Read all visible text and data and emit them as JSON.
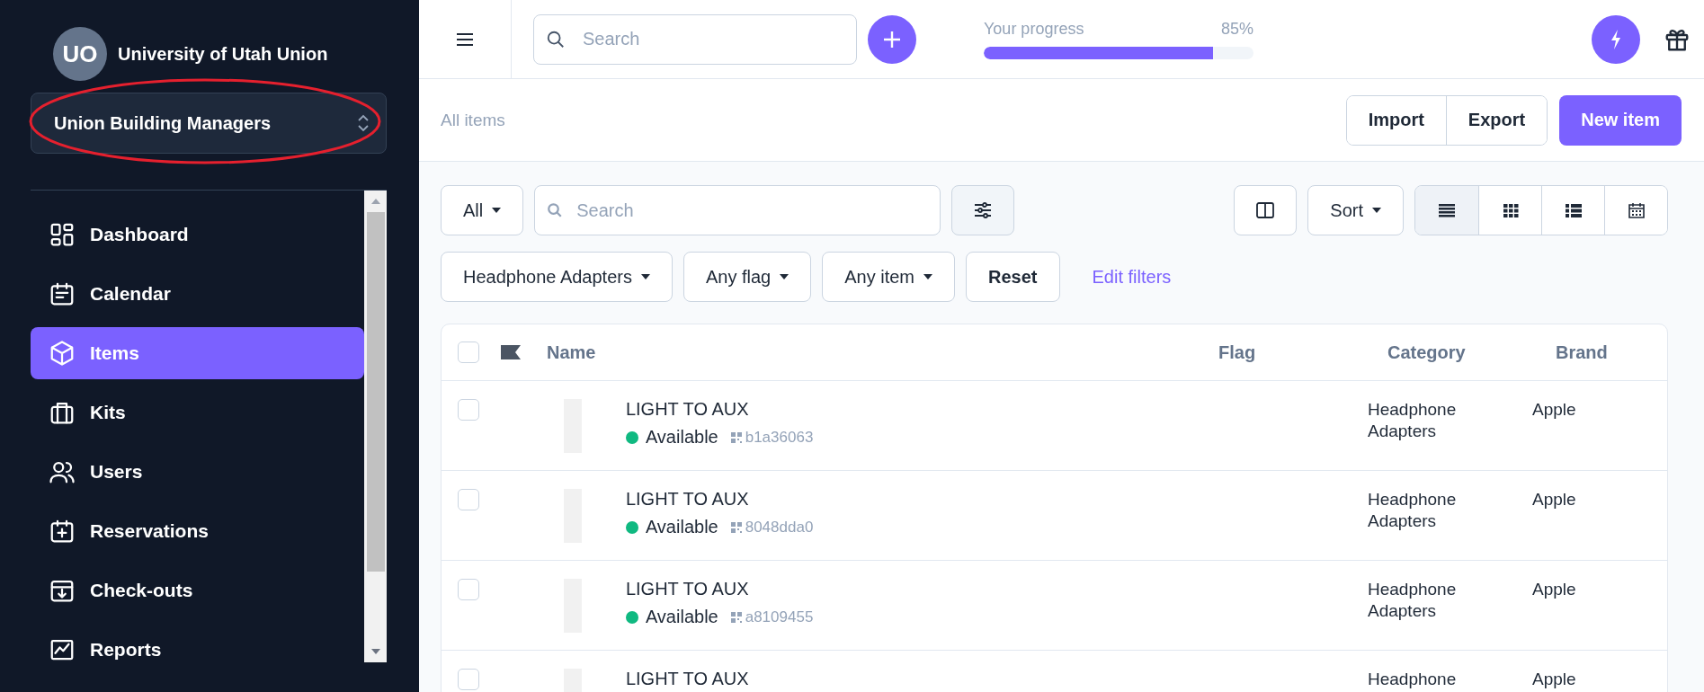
{
  "sidebar": {
    "org": {
      "initials": "UO",
      "name": "University of Utah Union"
    },
    "team_selector": {
      "label": "Union Building Managers"
    },
    "nav": [
      {
        "label": "Dashboard",
        "selected": false
      },
      {
        "label": "Calendar",
        "selected": false
      },
      {
        "label": "Items",
        "selected": true
      },
      {
        "label": "Kits",
        "selected": false
      },
      {
        "label": "Users",
        "selected": false
      },
      {
        "label": "Reservations",
        "selected": false
      },
      {
        "label": "Check-outs",
        "selected": false
      },
      {
        "label": "Reports",
        "selected": false
      }
    ]
  },
  "annotation": {
    "kind": "ellipse",
    "color": "#e5202e"
  },
  "topbar": {
    "search": {
      "placeholder": "Search"
    },
    "progress": {
      "label": "Your progress",
      "reading": "85%",
      "level": 0.85
    }
  },
  "header": {
    "breadcrumb": "All items",
    "buttons": [
      "Import",
      "Export"
    ],
    "primary_button": "New item"
  },
  "filters": {
    "scope": "All",
    "search": {
      "placeholder": "Search"
    },
    "sort": "Sort",
    "views": [
      {
        "selected": true
      },
      {
        "selected": false
      },
      {
        "selected": false
      },
      {
        "selected": false
      }
    ],
    "chips": [
      "Headphone Adapters",
      "Any flag",
      "Any item"
    ],
    "reset": "Reset",
    "edit_link": "Edit filters"
  },
  "table": {
    "select_all": {
      "checked": false
    },
    "columns": [
      "Name",
      "Flag",
      "Category",
      "Brand"
    ],
    "rows": [
      {
        "checked": false,
        "name": "LIGHT TO AUX",
        "status": "Available",
        "color": "#10b981",
        "code": "b1a36063",
        "category": "Headphone Adapters",
        "brand": "Apple"
      },
      {
        "checked": false,
        "name": "LIGHT TO AUX",
        "status": "Available",
        "color": "#10b981",
        "code": "8048dda0",
        "category": "Headphone Adapters",
        "brand": "Apple"
      },
      {
        "checked": false,
        "name": "LIGHT TO AUX",
        "status": "Available",
        "color": "#10b981",
        "code": "a8109455",
        "category": "Headphone Adapters",
        "brand": "Apple"
      },
      {
        "checked": false,
        "name": "LIGHT TO AUX",
        "category": "Headphone",
        "brand": "Apple"
      }
    ]
  }
}
